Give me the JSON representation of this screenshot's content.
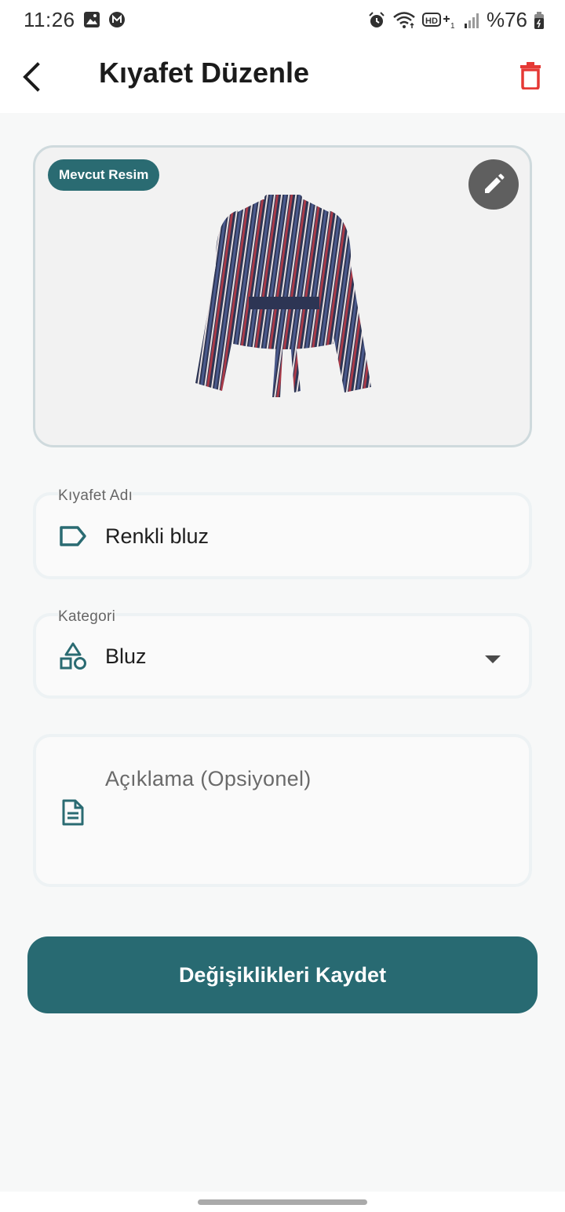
{
  "status_bar": {
    "time": "11:26",
    "battery": "%76",
    "left_icons": [
      "gallery-icon",
      "m-app-icon"
    ],
    "right_icons": [
      "alarm-icon",
      "wifi-icon",
      "hd-voice-icon",
      "signal-icon",
      "battery-icon"
    ]
  },
  "app_bar": {
    "title": "Kıyafet Düzenle",
    "back_icon": "back-arrow-icon",
    "delete_icon": "trash-icon",
    "delete_color": "#e53935"
  },
  "image_card": {
    "badge": "Mevcut Resim",
    "edit_icon": "pencil-icon"
  },
  "form": {
    "name_field": {
      "label": "Kıyafet Adı",
      "value": "Renkli bluz",
      "icon": "label-tag-icon"
    },
    "category_field": {
      "label": "Kategori",
      "value": "Bluz",
      "icon": "shapes-icon"
    },
    "description_field": {
      "placeholder": "Açıklama (Opsiyonel)",
      "icon": "document-icon"
    }
  },
  "save_button": {
    "label": "Değişiklikleri Kaydet"
  },
  "colors": {
    "primary": "#286a72",
    "danger": "#e53935",
    "background": "#f7f8f8"
  }
}
